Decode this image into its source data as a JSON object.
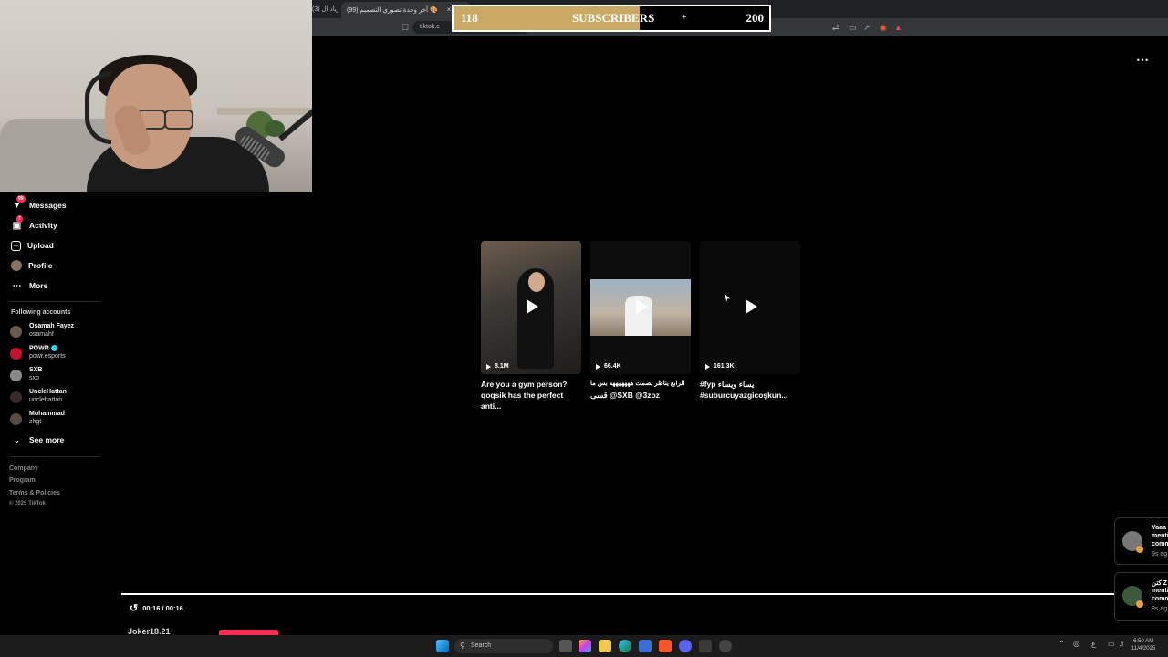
{
  "browser": {
    "tabs": [
      {
        "label": "(3) زياد ال"
      },
      {
        "label": "(99) آخر وحدة تصوري التصميم 🎨",
        "close": "×"
      }
    ],
    "url": "tiktok.c"
  },
  "overlay": {
    "current": "118",
    "label": "SUBSCRIBERS",
    "goal": "200",
    "plus": "+",
    "progress_fraction": 0.59
  },
  "sidebar": {
    "items": [
      {
        "label": "Messages",
        "icon": "send-icon",
        "badge": "99"
      },
      {
        "label": "Activity",
        "icon": "inbox-icon",
        "badge": "7"
      },
      {
        "label": "Upload",
        "icon": "plus-square-icon"
      },
      {
        "label": "Profile",
        "icon": "avatar"
      },
      {
        "label": "More",
        "icon": "ellipsis-icon"
      }
    ],
    "following_title": "Following accounts",
    "accounts": [
      {
        "name": "Osamah Fayez",
        "handle": "osamahf",
        "color": "#6a5a4e"
      },
      {
        "name": "POWR",
        "handle": "powr.esports",
        "color": "#c8102e",
        "verified": true
      },
      {
        "name": "SXB",
        "handle": "sxb",
        "color": "#888888"
      },
      {
        "name": "UncleHattan",
        "handle": "unclehattan",
        "color": "#3a2a2a"
      },
      {
        "name": "Mohammad",
        "handle": "zhgt",
        "color": "#5a4a44"
      }
    ],
    "see_more": "See more",
    "footer": [
      "Company",
      "Program",
      "Terms & Policies",
      "© 2025 TikTok"
    ]
  },
  "menu_icon": "⋯",
  "videos": [
    {
      "views": "8.1M",
      "caption_line1": "Are you a gym person?",
      "caption_line2": "qoqsik has the perfect anti..."
    },
    {
      "views": "66.4K",
      "caption_line1": "الرابع يناظر بصمت هههههههه بس ما",
      "caption_line2": "قسى @SXB @3zoz"
    },
    {
      "views": "161.3K",
      "caption_line1": "#fyp يساء ويساء",
      "caption_line2": "#suburcuyazgicoşkun..."
    }
  ],
  "player": {
    "time": "00:16 / 00:16",
    "next_user": "Joker18.21"
  },
  "notifications": [
    {
      "line1": "Yaaa",
      "line2": "menti",
      "line3": "comm",
      "time": "9s ag"
    },
    {
      "line1": "كتن Z",
      "line2": "menti",
      "line3": "comm",
      "time": "8s ag"
    }
  ],
  "taskbar": {
    "search": "Search",
    "lang": "ع",
    "time": "6:50 AM",
    "date": "11/4/2025"
  }
}
